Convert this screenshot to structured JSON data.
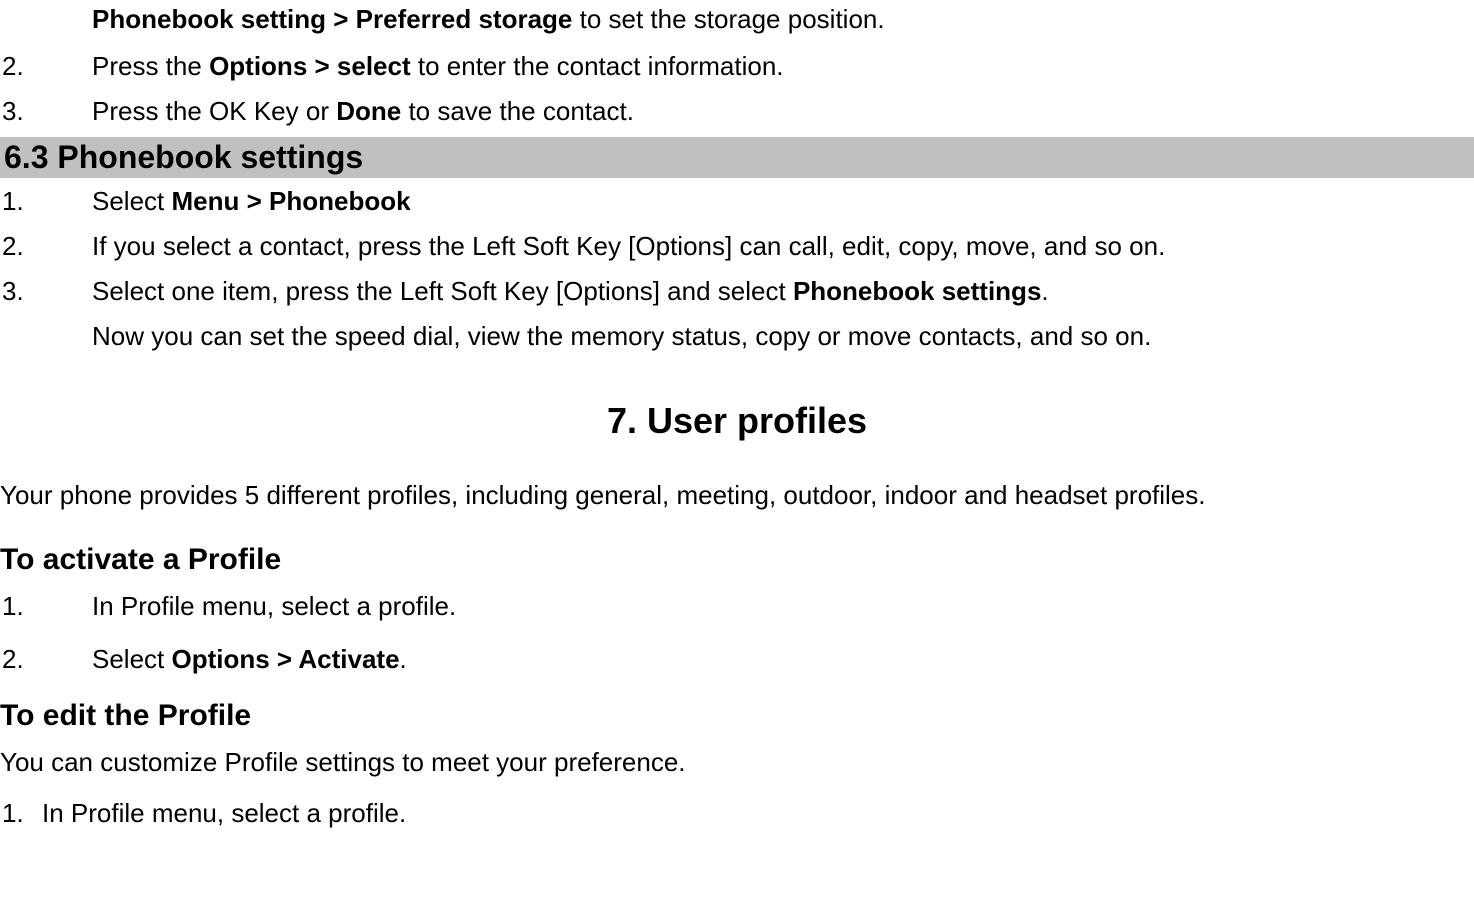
{
  "top": {
    "line1_bold": "Phonebook setting > Preferred storage",
    "line1_rest": " to set the storage position.",
    "item2_num": "2.",
    "item2_a": "Press the ",
    "item2_bold": "Options > select",
    "item2_b": " to enter the contact information.",
    "item3_num": "3.",
    "item3_a": "Press the OK Key or ",
    "item3_bold": "Done",
    "item3_b": " to save the contact."
  },
  "section63": {
    "heading": "6.3  Phonebook settings",
    "item1_num": "1.",
    "item1_a": "Select ",
    "item1_bold": "Menu > Phonebook",
    "item2_num": "2.",
    "item2_text": "If you select a contact, press the Left Soft Key [Options] can call, edit, copy, move, and so on.",
    "item3_num": "3.",
    "item3_a": "Select one item, press the Left Soft Key [Options] and select ",
    "item3_bold": "Phonebook settings",
    "item3_b": ".",
    "tail": "Now you can set the speed dial, view the memory status, copy or move contacts, and so on."
  },
  "section7": {
    "heading": "7.   User profiles",
    "intro": "Your phone provides 5 different profiles, including general, meeting, outdoor, indoor and headset profiles.",
    "activate_head": "To activate a Profile",
    "a1_num": "1.",
    "a1_text": "In Profile menu, select a profile.",
    "a2_num": "2.",
    "a2_a": "Select ",
    "a2_bold": "Options > Activate",
    "a2_b": ".",
    "edit_head": "To edit the Profile",
    "edit_para": "You can customize Profile settings to meet your preference.",
    "e1_num": "1.",
    "e1_text": "In Profile menu, select a profile."
  }
}
